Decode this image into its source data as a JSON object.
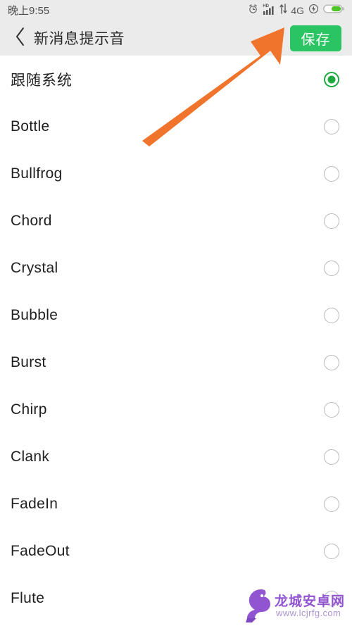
{
  "statusbar": {
    "time": "晚上9:55",
    "network_label": "4G",
    "hd_badge": "HD",
    "icons": [
      "alarm-icon",
      "signal-bars-icon",
      "data-transfer-icon",
      "network-type-label",
      "flash-charging-icon",
      "battery-icon"
    ],
    "battery_level_percent": 62,
    "bg_color": "#EBEBEB",
    "battery_fill_color": "#4CC425"
  },
  "header": {
    "back_icon": "chevron-left-icon",
    "title": "新消息提示音",
    "save_label": "保存",
    "save_color": "#2BC463",
    "bg_color": "#EBEBEB"
  },
  "list": {
    "selected_index": 0,
    "selected_color": "#1FAA41",
    "unselected_color": "#B8B8B8",
    "items": [
      {
        "label": "跟随系统",
        "selected": true,
        "cjk": true
      },
      {
        "label": "Bottle",
        "selected": false,
        "cjk": false
      },
      {
        "label": "Bullfrog",
        "selected": false,
        "cjk": false
      },
      {
        "label": "Chord",
        "selected": false,
        "cjk": false
      },
      {
        "label": "Crystal",
        "selected": false,
        "cjk": false
      },
      {
        "label": "Bubble",
        "selected": false,
        "cjk": false
      },
      {
        "label": "Burst",
        "selected": false,
        "cjk": false
      },
      {
        "label": "Chirp",
        "selected": false,
        "cjk": false
      },
      {
        "label": "Clank",
        "selected": false,
        "cjk": false
      },
      {
        "label": "FadeIn",
        "selected": false,
        "cjk": false
      },
      {
        "label": "FadeOut",
        "selected": false,
        "cjk": false
      },
      {
        "label": "Flute",
        "selected": false,
        "cjk": false
      }
    ]
  },
  "annotation": {
    "arrow_color": "#F0742B",
    "points_to": "保存"
  },
  "watermark": {
    "site_name": "龙城安卓网",
    "url": "www.lcjrfg.com",
    "logo_icon": "dragon-logo-icon",
    "color": "#8E4FD0"
  }
}
